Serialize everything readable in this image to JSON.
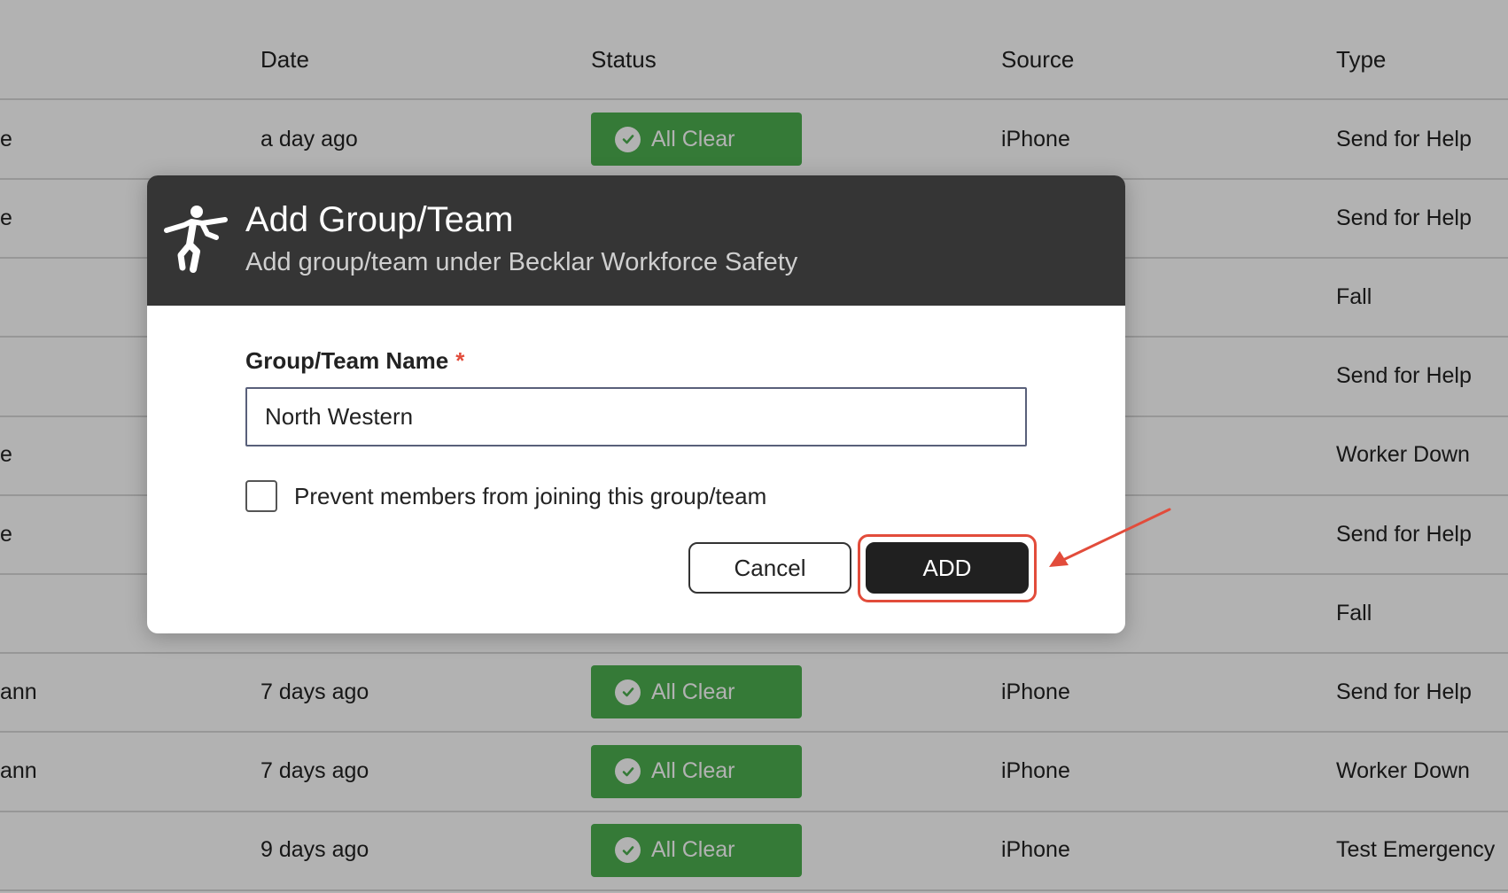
{
  "table": {
    "headers": {
      "date": "Date",
      "status": "Status",
      "source": "Source",
      "type": "Type"
    },
    "rows": [
      {
        "name": "e",
        "date": "a day ago",
        "status": "All Clear",
        "source": "iPhone",
        "type": "Send for Help"
      },
      {
        "name": "e",
        "date": "",
        "status": "",
        "source": "",
        "type": "Send for Help"
      },
      {
        "name": "",
        "date": "",
        "status": "",
        "source": "",
        "type": "Fall"
      },
      {
        "name": "",
        "date": "",
        "status": "",
        "source": "",
        "type": "Send for Help"
      },
      {
        "name": "e",
        "date": "",
        "status": "",
        "source": "",
        "type": "Worker Down"
      },
      {
        "name": "e",
        "date": "",
        "status": "",
        "source": "",
        "type": "Send for Help"
      },
      {
        "name": "",
        "date": "",
        "status": "",
        "source": "",
        "type": "Fall"
      },
      {
        "name": "ann",
        "date": "7 days ago",
        "status": "All Clear",
        "source": "iPhone",
        "type": "Send for Help"
      },
      {
        "name": "ann",
        "date": "7 days ago",
        "status": "All Clear",
        "source": "iPhone",
        "type": "Worker Down"
      },
      {
        "name": "",
        "date": "9 days ago",
        "status": "All Clear",
        "source": "iPhone",
        "type": "Test Emergency"
      }
    ]
  },
  "modal": {
    "title": "Add Group/Team",
    "subtitle": "Add group/team under Becklar Workforce Safety",
    "header_icon": "falling-person-icon",
    "field_label": "Group/Team Name",
    "required_marker": "*",
    "input_value": "North Western",
    "checkbox_label": "Prevent members from joining this group/team",
    "checkbox_checked": false,
    "cancel_label": "Cancel",
    "add_label": "ADD"
  },
  "colors": {
    "status_green": "#4caf50",
    "header_dark": "#353535",
    "annotation_red": "#e24c3b",
    "add_button": "#202020"
  }
}
